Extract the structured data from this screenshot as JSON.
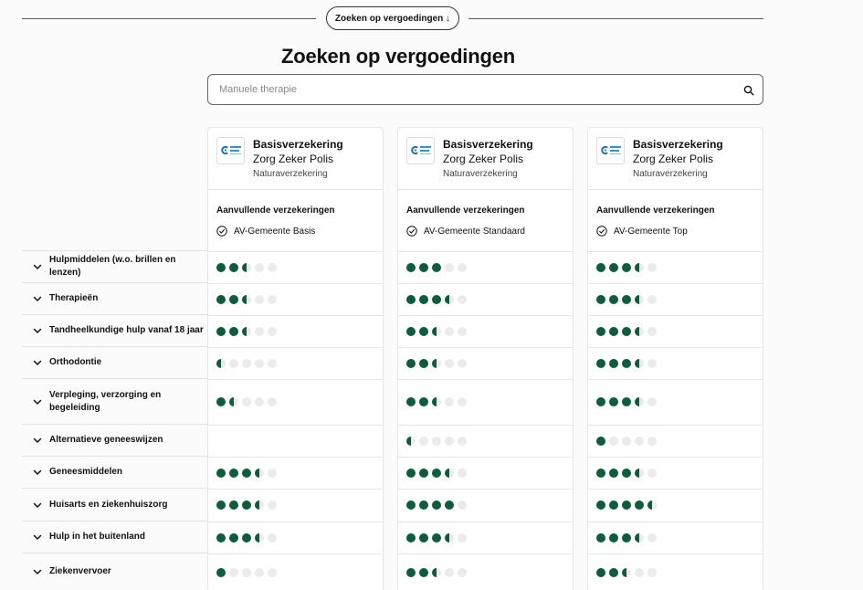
{
  "top_button": {
    "label": "Zoeken op vergoedingen ↓"
  },
  "page_title": "Zoeken op vergoedingen",
  "search": {
    "placeholder": "Manuele therapie",
    "icon": "search-icon"
  },
  "colors": {
    "accent": "#0d5c3c",
    "dot_empty": "#ebebeb"
  },
  "categories": [
    "Hulpmiddelen (w.o. brillen en lenzen)",
    "Therapieën",
    "Tandheelkundige hulp vanaf 18 jaar",
    "Orthodontie",
    "Verpleging, verzorging en begeleiding",
    "Alternatieve geneeswijzen",
    "Geneesmiddelen",
    "Huisarts en ziekenhuiszorg",
    "Hulp in het buitenland",
    "Ziekenvervoer"
  ],
  "cards": [
    {
      "title": "Basisverzekering",
      "subtitle": "Zorg Zeker Polis",
      "type": "Naturaverzekering",
      "additional_label": "Aanvullende verzekeringen",
      "additional_item": "AV-Gemeente Basis",
      "ratings": [
        2.5,
        2.5,
        2.5,
        0.5,
        1.5,
        null,
        3.5,
        3.5,
        3.5,
        1
      ]
    },
    {
      "title": "Basisverzekering",
      "subtitle": "Zorg Zeker Polis",
      "type": "Naturaverzekering",
      "additional_label": "Aanvullende verzekeringen",
      "additional_item": "AV-Gemeente Standaard",
      "ratings": [
        3,
        3.5,
        2.5,
        2.5,
        2.5,
        0.5,
        3.5,
        4,
        3.5,
        2.5
      ]
    },
    {
      "title": "Basisverzekering",
      "subtitle": "Zorg Zeker Polis",
      "type": "Naturaverzekering",
      "additional_label": "Aanvullende verzekeringen",
      "additional_item": "AV-Gemeente Top",
      "ratings": [
        3.5,
        3.5,
        3.5,
        3.5,
        3.5,
        1,
        3.5,
        4.5,
        3.5,
        2.5
      ]
    }
  ]
}
